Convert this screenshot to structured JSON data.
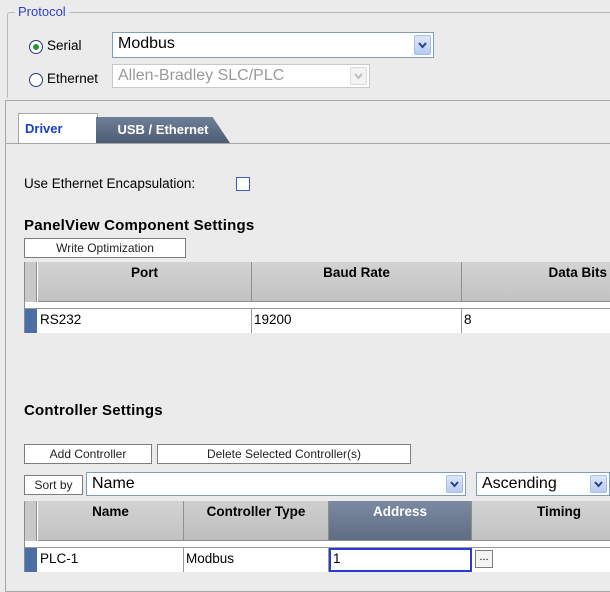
{
  "protocol": {
    "legend": "Protocol",
    "serial": {
      "label": "Serial",
      "selected": true,
      "value": "Modbus"
    },
    "ethernet": {
      "label": "Ethernet",
      "selected": false,
      "value": "Allen-Bradley SLC/PLC"
    }
  },
  "tabs": [
    {
      "label": "Driver",
      "active": true
    },
    {
      "label": "USB / Ethernet",
      "active": false
    }
  ],
  "encapsulation": {
    "label": "Use Ethernet Encapsulation:",
    "checked": false
  },
  "panelview": {
    "title": "PanelView Component Settings",
    "write_optimization_label": "Write Optimization",
    "columns": [
      "Port",
      "Baud Rate",
      "Data Bits"
    ],
    "rows": [
      [
        "RS232",
        "19200",
        "8"
      ]
    ]
  },
  "controller": {
    "title": "Controller Settings",
    "add_label": "Add Controller",
    "delete_label": "Delete Selected Controller(s)",
    "sort_by_label": "Sort by",
    "sort_field": "Name",
    "sort_order": "Ascending",
    "columns": [
      "Name",
      "Controller Type",
      "Address",
      "Timing"
    ],
    "rows": [
      [
        "PLC-1",
        "Modbus",
        "1",
        "..."
      ]
    ]
  },
  "icons": {
    "dropdown": "chevron-down-icon",
    "radio": "radio-icon",
    "checkbox": "checkbox-icon"
  },
  "colors": {
    "accent_blue": "#1a3fc8",
    "tab_inactive": "#5a6a84",
    "active_header": "#6d7b93"
  }
}
